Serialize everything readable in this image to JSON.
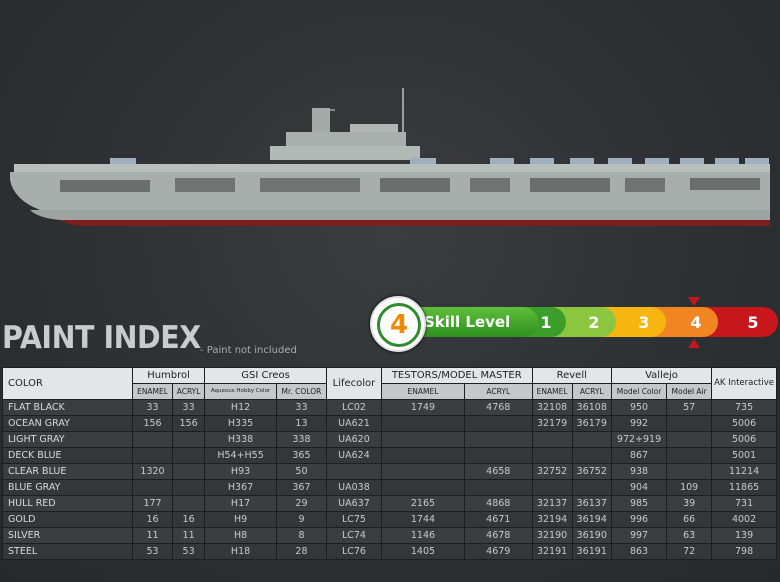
{
  "title": "PAINT INDEX",
  "note": "- Paint not included",
  "skill": {
    "badge": "4",
    "label": "Skill Level",
    "levels": [
      "1",
      "2",
      "3",
      "4",
      "5"
    ],
    "colors": [
      "#3c9e2a",
      "#8cc63f",
      "#f7b50f",
      "#f08522",
      "#c8161d"
    ]
  },
  "table": {
    "color_header": "COLOR",
    "lifecolor_header": "Lifecolor",
    "ak_header": "AK Interactive",
    "groups": [
      {
        "name": "Humbrol",
        "subs": [
          "ENAMEL",
          "ACRYL"
        ]
      },
      {
        "name": "GSI Creos",
        "subs": [
          "Aqueous Hobby Color",
          "Mr. COLOR"
        ]
      },
      {
        "name": "TESTORS/MODEL MASTER",
        "subs": [
          "ENAMEL",
          "ACRYL"
        ]
      },
      {
        "name": "Revell",
        "subs": [
          "ENAMEL",
          "ACRYL"
        ]
      },
      {
        "name": "Vallejo",
        "subs": [
          "Model Color",
          "Model Air"
        ]
      }
    ],
    "rows": [
      {
        "name": "FLAT BLACK",
        "hum_en": "33",
        "hum_ac": "33",
        "gsi_aq": "H12",
        "gsi_mr": "33",
        "life": "LC02",
        "tes_en": "1749",
        "tes_ac": "4768",
        "rev_en": "32108",
        "rev_ac": "36108",
        "val_mc": "950",
        "val_ma": "57",
        "ak": "735"
      },
      {
        "name": "OCEAN GRAY",
        "hum_en": "156",
        "hum_ac": "156",
        "gsi_aq": "H335",
        "gsi_mr": "13",
        "life": "UA621",
        "tes_en": "",
        "tes_ac": "",
        "rev_en": "32179",
        "rev_ac": "36179",
        "val_mc": "992",
        "val_ma": "",
        "ak": "5006"
      },
      {
        "name": "LIGHT GRAY",
        "hum_en": "",
        "hum_ac": "",
        "gsi_aq": "H338",
        "gsi_mr": "338",
        "life": "UA620",
        "tes_en": "",
        "tes_ac": "",
        "rev_en": "",
        "rev_ac": "",
        "val_mc": "972+919",
        "val_ma": "",
        "ak": "5006"
      },
      {
        "name": "DECK BLUE",
        "hum_en": "",
        "hum_ac": "",
        "gsi_aq": "H54+H55",
        "gsi_mr": "365",
        "life": "UA624",
        "tes_en": "",
        "tes_ac": "",
        "rev_en": "",
        "rev_ac": "",
        "val_mc": "867",
        "val_ma": "",
        "ak": "5001"
      },
      {
        "name": "CLEAR BLUE",
        "hum_en": "1320",
        "hum_ac": "",
        "gsi_aq": "H93",
        "gsi_mr": "50",
        "life": "",
        "tes_en": "",
        "tes_ac": "4658",
        "rev_en": "32752",
        "rev_ac": "36752",
        "val_mc": "938",
        "val_ma": "",
        "ak": "11214"
      },
      {
        "name": "BLUE  GRAY",
        "hum_en": "",
        "hum_ac": "",
        "gsi_aq": "H367",
        "gsi_mr": "367",
        "life": "UA038",
        "tes_en": "",
        "tes_ac": "",
        "rev_en": "",
        "rev_ac": "",
        "val_mc": "904",
        "val_ma": "109",
        "ak": "11865"
      },
      {
        "name": "HULL RED",
        "hum_en": "177",
        "hum_ac": "",
        "gsi_aq": "H17",
        "gsi_mr": "29",
        "life": "UA637",
        "tes_en": "2165",
        "tes_ac": "4868",
        "rev_en": "32137",
        "rev_ac": "36137",
        "val_mc": "985",
        "val_ma": "39",
        "ak": "731"
      },
      {
        "name": "GOLD",
        "hum_en": "16",
        "hum_ac": "16",
        "gsi_aq": "H9",
        "gsi_mr": "9",
        "life": "LC75",
        "tes_en": "1744",
        "tes_ac": "4671",
        "rev_en": "32194",
        "rev_ac": "36194",
        "val_mc": "996",
        "val_ma": "66",
        "ak": "4002"
      },
      {
        "name": "SILVER",
        "hum_en": "11",
        "hum_ac": "11",
        "gsi_aq": "H8",
        "gsi_mr": "8",
        "life": "LC74",
        "tes_en": "1146",
        "tes_ac": "4678",
        "rev_en": "32190",
        "rev_ac": "36190",
        "val_mc": "997",
        "val_ma": "63",
        "ak": "139"
      },
      {
        "name": "STEEL",
        "hum_en": "53",
        "hum_ac": "53",
        "gsi_aq": "H18",
        "gsi_mr": "28",
        "life": "LC76",
        "tes_en": "1405",
        "tes_ac": "4679",
        "rev_en": "32191",
        "rev_ac": "36191",
        "val_mc": "863",
        "val_ma": "72",
        "ak": "798"
      }
    ]
  }
}
